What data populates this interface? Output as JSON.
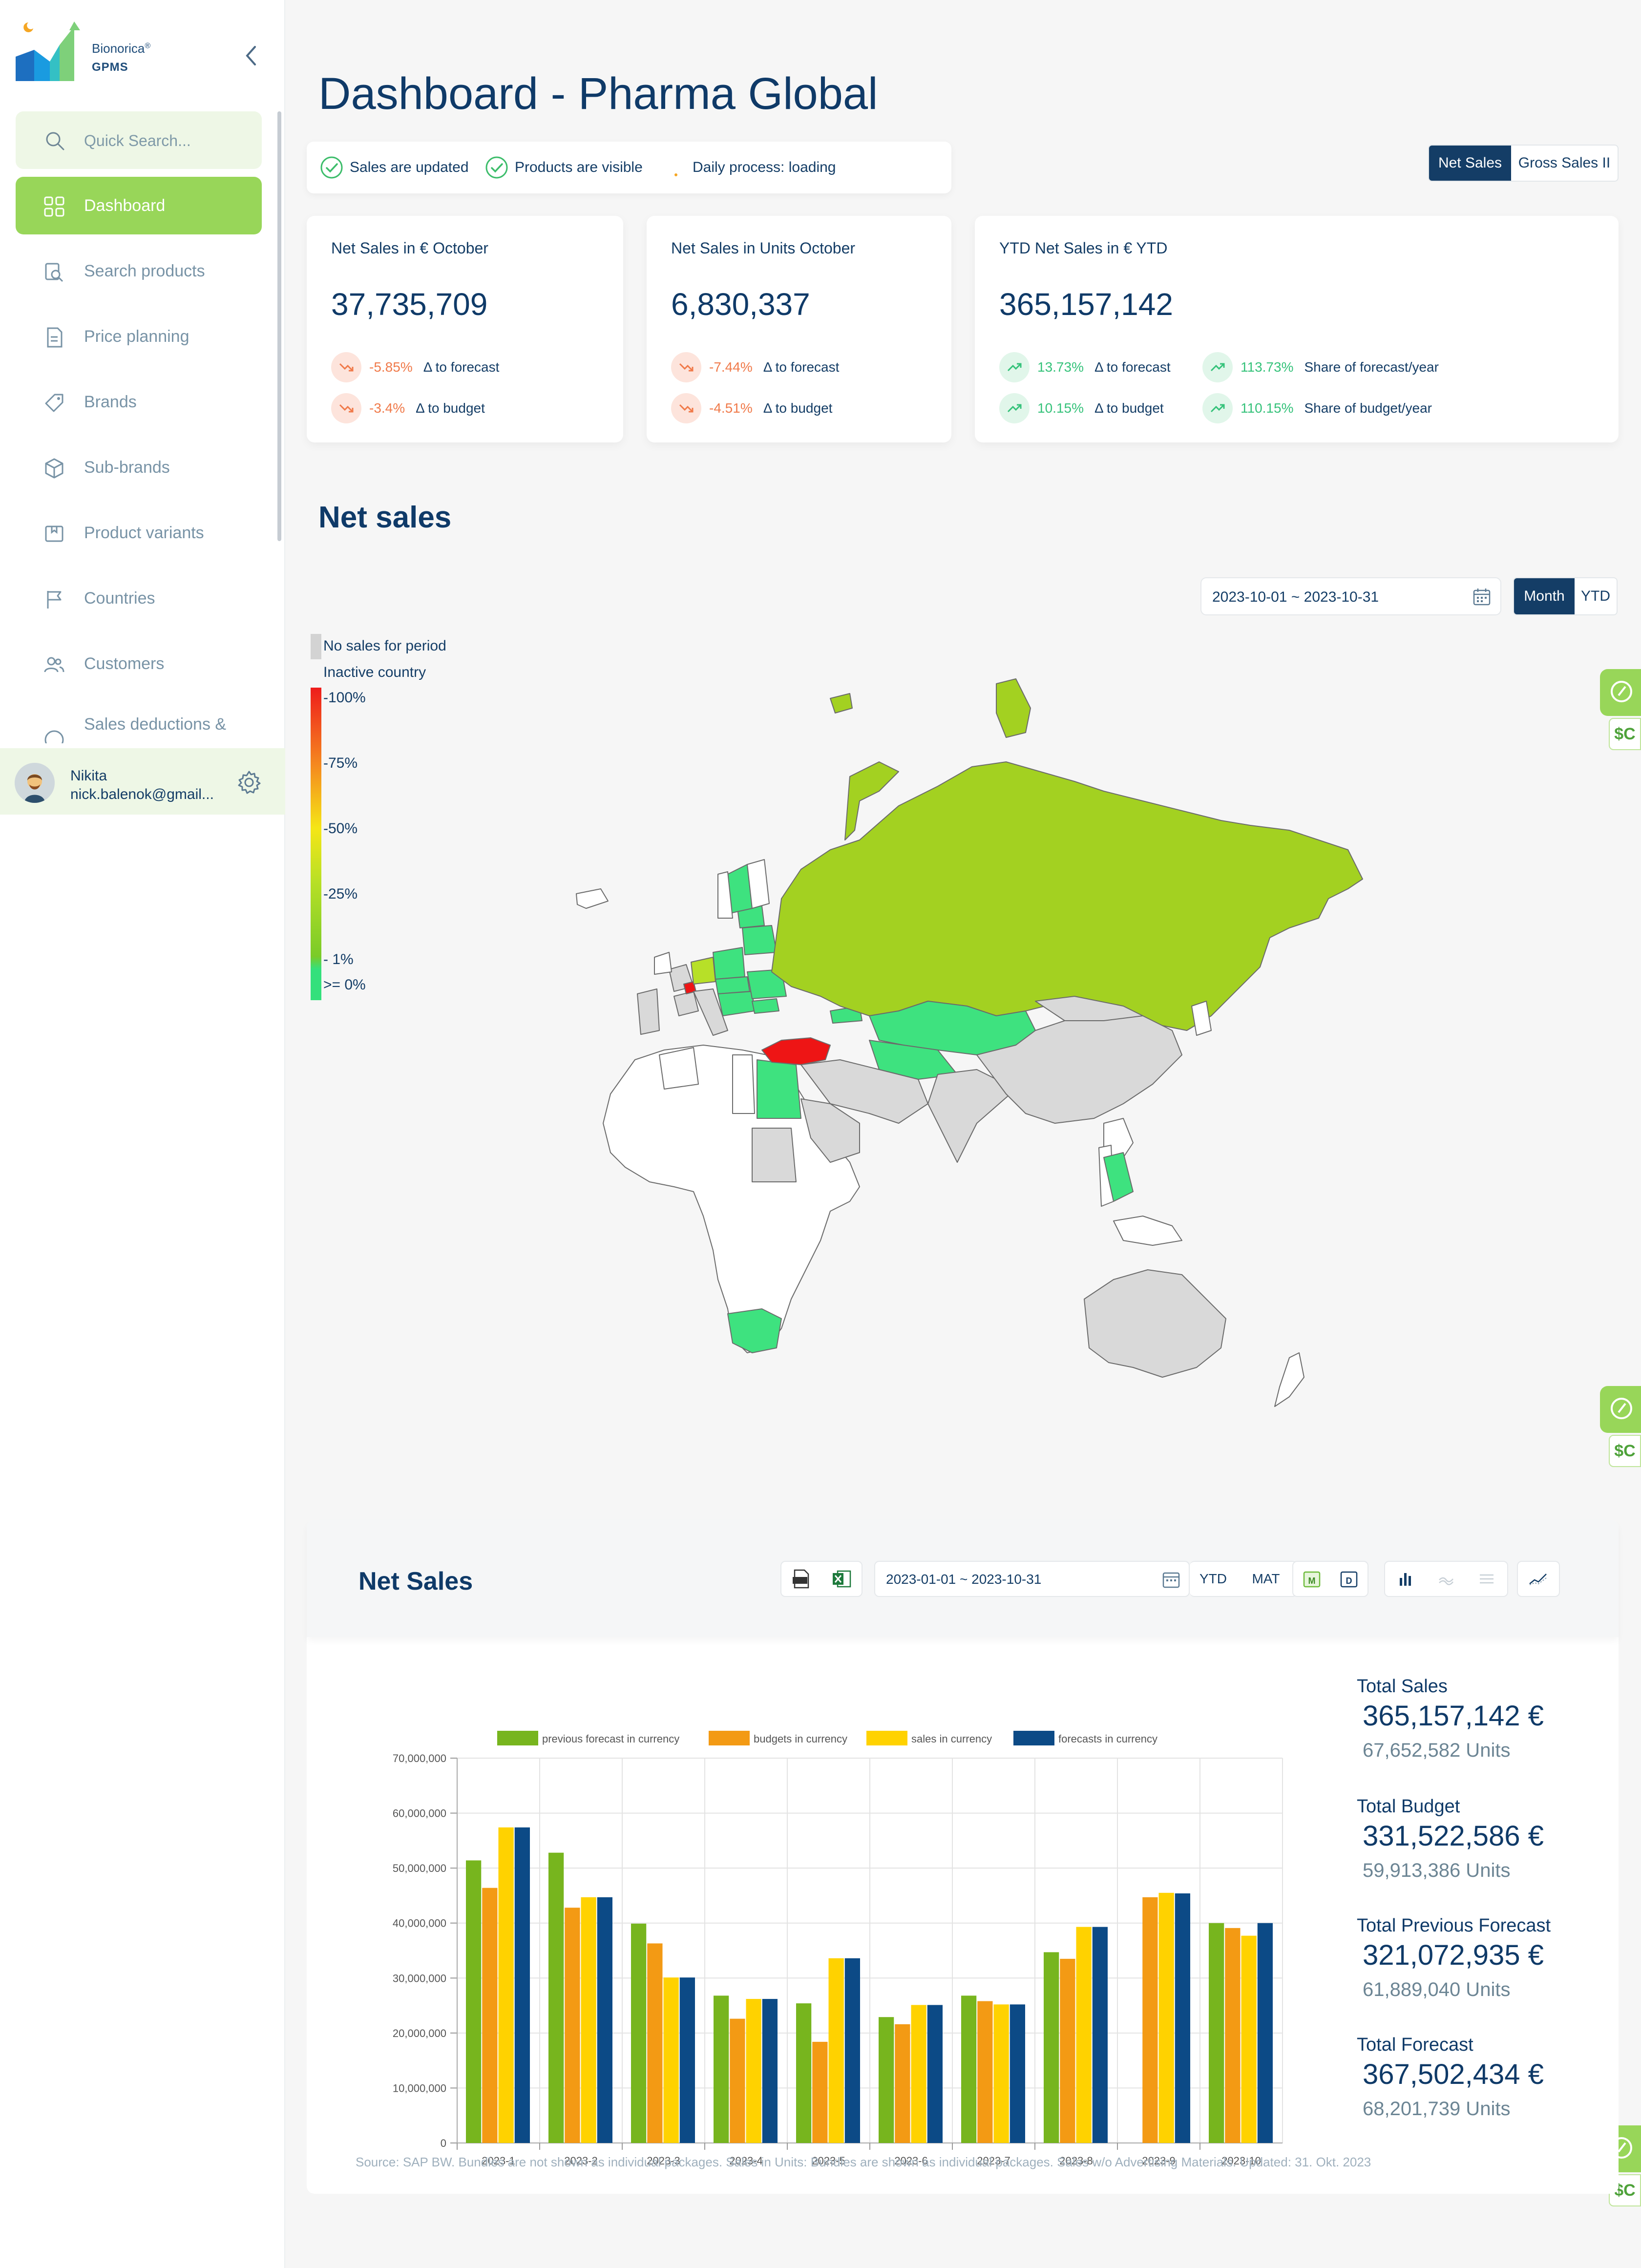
{
  "app": {
    "brand": "Bionorica",
    "brand_mark": "®",
    "product": "GPMS"
  },
  "sidebar": {
    "search_placeholder": "Quick Search...",
    "items": [
      {
        "label": "Dashboard",
        "icon": "grid-icon",
        "active": true
      },
      {
        "label": "Search products",
        "icon": "search-products-icon",
        "active": false
      },
      {
        "label": "Price planning",
        "icon": "price-planning-icon",
        "active": false
      },
      {
        "label": "Brands",
        "icon": "tag-icon",
        "active": false
      },
      {
        "label": "Sub-brands",
        "icon": "box-icon",
        "active": false
      },
      {
        "label": "Product variants",
        "icon": "variant-icon",
        "active": false
      },
      {
        "label": "Countries",
        "icon": "flag-icon",
        "active": false
      },
      {
        "label": "Customers",
        "icon": "users-icon",
        "active": false
      },
      {
        "label": "Sales deductions &",
        "icon": "percent-icon",
        "active": false
      }
    ],
    "user": {
      "name": "Nikita",
      "email": "nick.balenok@gmail..."
    }
  },
  "header": {
    "title": "Dashboard - Pharma Global",
    "status": [
      {
        "text": "Sales are updated",
        "state": "ok"
      },
      {
        "text": "Products are visible",
        "state": "ok"
      },
      {
        "text": "Daily process: loading",
        "state": "loading"
      }
    ],
    "sales_toggle": [
      {
        "label": "Net Sales",
        "active": true
      },
      {
        "label": "Gross Sales II",
        "active": false
      }
    ]
  },
  "kpis": [
    {
      "title": "Net Sales in € October",
      "value": "37,735,709",
      "rows": [
        {
          "pct": "-5.85%",
          "desc": "Δ to forecast",
          "trend": "down"
        },
        {
          "pct": "-3.4%",
          "desc": "Δ to budget",
          "trend": "down"
        }
      ]
    },
    {
      "title": "Net Sales in Units October",
      "value": "6,830,337",
      "rows": [
        {
          "pct": "-7.44%",
          "desc": "Δ to forecast",
          "trend": "down"
        },
        {
          "pct": "-4.51%",
          "desc": "Δ to budget",
          "trend": "down"
        }
      ]
    },
    {
      "title": "YTD Net Sales in € YTD",
      "value": "365,157,142",
      "rows": [
        {
          "pct": "13.73%",
          "desc": "Δ to forecast",
          "trend": "up"
        },
        {
          "pct": "10.15%",
          "desc": "Δ to budget",
          "trend": "up"
        },
        {
          "pct": "113.73%",
          "desc": "Share of forecast/year",
          "trend": "up"
        },
        {
          "pct": "110.15%",
          "desc": "Share of budget/year",
          "trend": "up"
        }
      ]
    }
  ],
  "map_section": {
    "title": "Net sales",
    "date_range": "2023-10-01 ~ 2023-10-31",
    "period_toggle": [
      {
        "label": "Month",
        "active": true
      },
      {
        "label": "YTD",
        "active": false
      }
    ],
    "legend": [
      {
        "label": "No sales for period",
        "color": "#d3d3d3"
      },
      {
        "label": "Inactive country",
        "color": "#ffffff"
      },
      {
        "label": "-100%",
        "color": "#ee1c1c"
      },
      {
        "label": "-75%",
        "color": "#f58a1f"
      },
      {
        "label": "-50%",
        "color": "#f5e616"
      },
      {
        "label": "-25%",
        "color": "#b8e026"
      },
      {
        "label": "- 1%",
        "color": "#7acb28"
      },
      {
        "label": ">= 0%",
        "color": "#34e07c"
      }
    ],
    "colors": {
      "russia": "#a3d121",
      "turkey": "#ee1515",
      "positive": "#3ee27f",
      "no_sales": "#d9d9d9",
      "inactive": "#ffffff",
      "mid": "#b7e028"
    }
  },
  "side_tab_label": "$C",
  "chart_section": {
    "title": "Net Sales",
    "date_range": "2023-01-01 ~ 2023-10-31",
    "tools": {
      "ytd": "YTD",
      "mat": "MAT"
    },
    "totals": [
      {
        "label": "Total Sales",
        "value": "365,157,142 €",
        "units": "67,652,582 Units"
      },
      {
        "label": "Total Budget",
        "value": "331,522,586 €",
        "units": "59,913,386 Units"
      },
      {
        "label": "Total Previous Forecast",
        "value": "321,072,935 €",
        "units": "61,889,040 Units"
      },
      {
        "label": "Total Forecast",
        "value": "367,502,434 €",
        "units": "68,201,739 Units"
      }
    ],
    "source_note": "Source: SAP BW. Bundles are not shown as individual packages. Sales in Units: Bundles are shown as individual packages. Sales w/o Advertising Materials. Updated: 31. Okt. 2023"
  },
  "chart_data": {
    "type": "bar",
    "categories": [
      "2023-1",
      "2023-2",
      "2023-3",
      "2023-4",
      "2023-5",
      "2023-6",
      "2023-7",
      "2023-8",
      "2023-9",
      "2023-10"
    ],
    "series": [
      {
        "name": "previous forecast in currency",
        "color": "#77b51e",
        "values": [
          51400000,
          52800000,
          39900000,
          26800000,
          25400000,
          22900000,
          26800000,
          34700000,
          0,
          40000000
        ]
      },
      {
        "name": "budgets in currency",
        "color": "#f39a14",
        "values": [
          46400000,
          42800000,
          36300000,
          22600000,
          18400000,
          21600000,
          25800000,
          33500000,
          44700000,
          39100000
        ]
      },
      {
        "name": "sales in currency",
        "color": "#ffd200",
        "values": [
          57400000,
          44700000,
          30100000,
          26200000,
          33600000,
          25100000,
          25200000,
          39300000,
          45500000,
          37700000
        ]
      },
      {
        "name": "forecasts in currency",
        "color": "#0c4a86",
        "values": [
          57400000,
          44700000,
          30100000,
          26200000,
          33600000,
          25100000,
          25200000,
          39300000,
          45400000,
          40000000
        ]
      }
    ],
    "ylim": [
      0,
      70000000
    ],
    "yticks": [
      "0",
      "10,000,000",
      "20,000,000",
      "30,000,000",
      "40,000,000",
      "50,000,000",
      "60,000,000",
      "70,000,000"
    ],
    "grid": true,
    "legend_position": "top"
  }
}
